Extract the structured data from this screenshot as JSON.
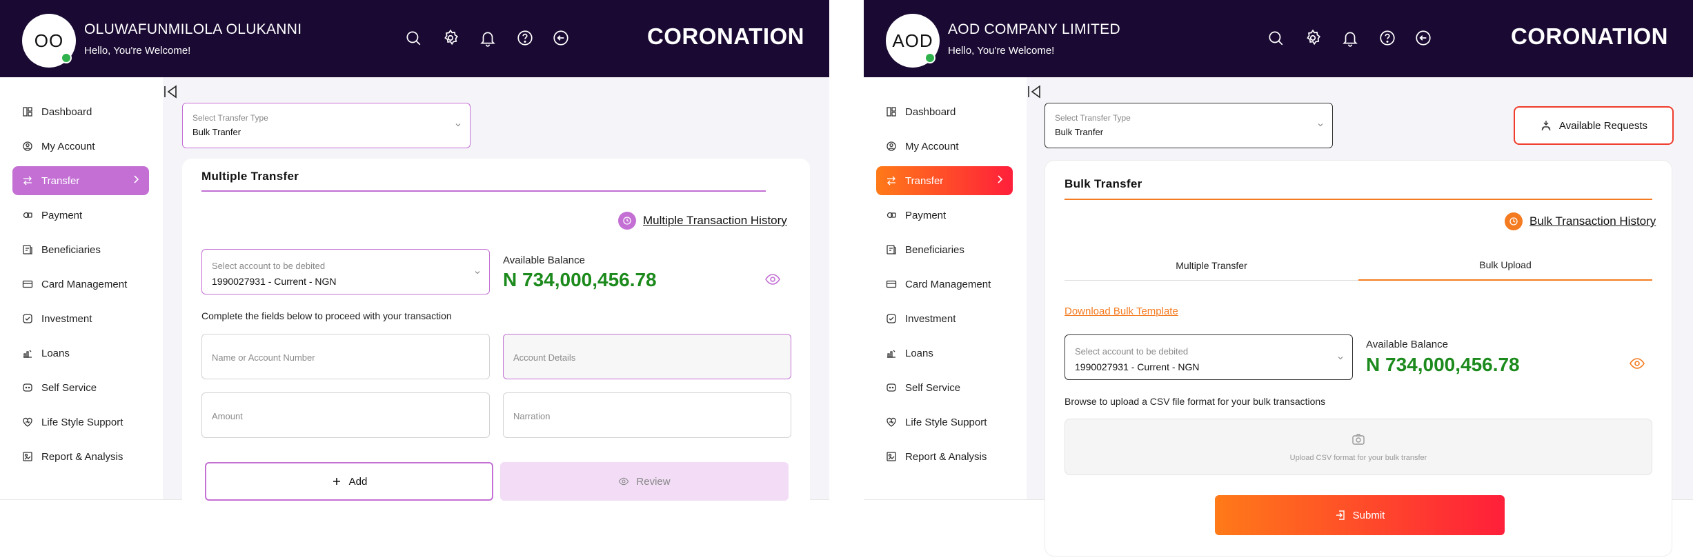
{
  "left": {
    "header": {
      "initials": "OO",
      "user_name": "OLUWAFUNMILOLA OLUKANNI",
      "greeting": "Hello, You're Welcome!",
      "brand": "CORONATION",
      "icons": [
        "search-icon",
        "settings-icon",
        "bell-icon",
        "help-icon",
        "logout-icon"
      ]
    },
    "sidebar": {
      "items": [
        {
          "label": "Dashboard",
          "icon": "dashboard-icon"
        },
        {
          "label": "My Account",
          "icon": "user-icon"
        },
        {
          "label": "Transfer",
          "icon": "transfer-icon",
          "active": true
        },
        {
          "label": "Payment",
          "icon": "payment-icon"
        },
        {
          "label": "Beneficiaries",
          "icon": "beneficiaries-icon"
        },
        {
          "label": "Card Management",
          "icon": "card-icon"
        },
        {
          "label": "Investment",
          "icon": "investment-icon"
        },
        {
          "label": "Loans",
          "icon": "loans-icon"
        },
        {
          "label": "Self Service",
          "icon": "self-service-icon"
        },
        {
          "label": "Life Style Support",
          "icon": "lifestyle-icon"
        },
        {
          "label": "Report & Analysis",
          "icon": "report-icon"
        }
      ]
    },
    "transfer_type": {
      "label": "Select Transfer Type",
      "value": "Bulk Tranfer"
    },
    "card": {
      "title": "Multiple Transfer",
      "history_link": "Multiple Transaction History",
      "account_select": {
        "label": "Select account to be debited",
        "value": "1990027931 - Current - NGN"
      },
      "balance_label": "Available Balance",
      "balance_value": "N 734,000,456.78",
      "instruction": "Complete the fields below to proceed with your transaction",
      "fields": {
        "name": "Name or Account Number",
        "details": "Account Details",
        "amount": "Amount",
        "narration": "Narration"
      },
      "add_label": "Add",
      "review_label": "Review"
    },
    "colors": {
      "accent": "#c36fd4",
      "active_bg": "#c36fd4",
      "review_bg": "#f2dcf6"
    }
  },
  "right": {
    "header": {
      "initials": "AOD",
      "user_name": "AOD COMPANY LIMITED",
      "greeting": "Hello, You're Welcome!",
      "brand": "CORONATION",
      "icons": [
        "search-icon",
        "settings-icon",
        "bell-icon",
        "help-icon",
        "logout-icon"
      ]
    },
    "sidebar": {
      "items": [
        {
          "label": "Dashboard",
          "icon": "dashboard-icon"
        },
        {
          "label": "My Account",
          "icon": "user-icon"
        },
        {
          "label": "Transfer",
          "icon": "transfer-icon",
          "active": true
        },
        {
          "label": "Payment",
          "icon": "payment-icon"
        },
        {
          "label": "Beneficiaries",
          "icon": "beneficiaries-icon"
        },
        {
          "label": "Card Management",
          "icon": "card-icon"
        },
        {
          "label": "Investment",
          "icon": "investment-icon"
        },
        {
          "label": "Loans",
          "icon": "loans-icon"
        },
        {
          "label": "Self Service",
          "icon": "self-service-icon"
        },
        {
          "label": "Life Style Support",
          "icon": "lifestyle-icon"
        },
        {
          "label": "Report & Analysis",
          "icon": "report-icon"
        }
      ]
    },
    "transfer_type": {
      "label": "Select Transfer Type",
      "value": "Bulk Tranfer"
    },
    "available_requests": "Available Requests",
    "card": {
      "title": "Bulk Transfer",
      "history_link": "Bulk Transaction History",
      "tabs": [
        {
          "label": "Multiple Transfer"
        },
        {
          "label": "Bulk Upload",
          "active": true
        }
      ],
      "download_link": "Download Bulk Template",
      "account_select": {
        "label": "Select account to be debited",
        "value": "1990027931 - Current - NGN"
      },
      "balance_label": "Available Balance",
      "balance_value": "N 734,000,456.78",
      "upload_instruction": "Browse to upload a CSV file format for your bulk transactions",
      "upload_hint": "Upload CSV format for your bulk transfer",
      "submit_label": "Submit"
    },
    "colors": {
      "accent": "#f47b20",
      "gradient_start": "#ff7a18",
      "gradient_end": "#ff1f3a"
    }
  }
}
